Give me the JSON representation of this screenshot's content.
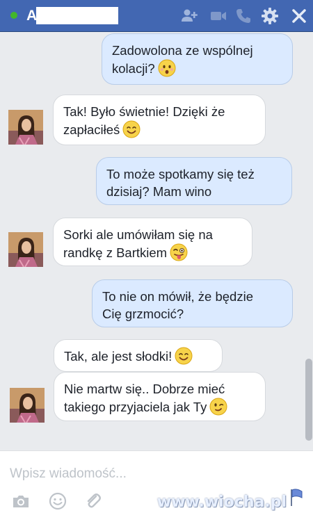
{
  "header": {
    "contact_initial": "A",
    "icons": [
      "add-friend-icon",
      "video-call-icon",
      "phone-icon",
      "gear-icon",
      "close-icon"
    ]
  },
  "messages": [
    {
      "side": "out",
      "lines": [
        "Zadowolona ze wspólnej",
        "kolacji?"
      ],
      "emoji": "surprised"
    },
    {
      "side": "in",
      "lines": [
        "Tak! Było świetnie! Dzięki że",
        "zapłaciłeś"
      ],
      "emoji": "smile"
    },
    {
      "side": "out",
      "lines": [
        "To może spotkamy się też",
        "dzisiaj? Mam wino"
      ]
    },
    {
      "side": "in",
      "lines": [
        "Sorki ale umówiłam się na",
        "randkę z Bartkiem"
      ],
      "emoji": "tongue"
    },
    {
      "side": "out",
      "lines": [
        "To nie on mówił, że będzie",
        "Cię grzmocić?"
      ]
    },
    {
      "side": "in",
      "lines": [
        "Tak, ale jest słodki!"
      ],
      "emoji": "smile"
    },
    {
      "side": "in",
      "lines": [
        "Nie martw się.. Dobrze mieć",
        "takiego przyjaciela jak Ty"
      ],
      "emoji": "wink"
    }
  ],
  "composer": {
    "placeholder": "Wpisz wiadomość...",
    "icons": [
      "camera-icon",
      "emoji-icon",
      "attachment-icon"
    ]
  },
  "watermark": "www.wiocha.pl",
  "colors": {
    "header": "#4267b2",
    "outgoing_bubble": "#dbeaff",
    "incoming_bubble": "#ffffff",
    "chat_background": "#e9ebee",
    "online": "#42b72a"
  }
}
